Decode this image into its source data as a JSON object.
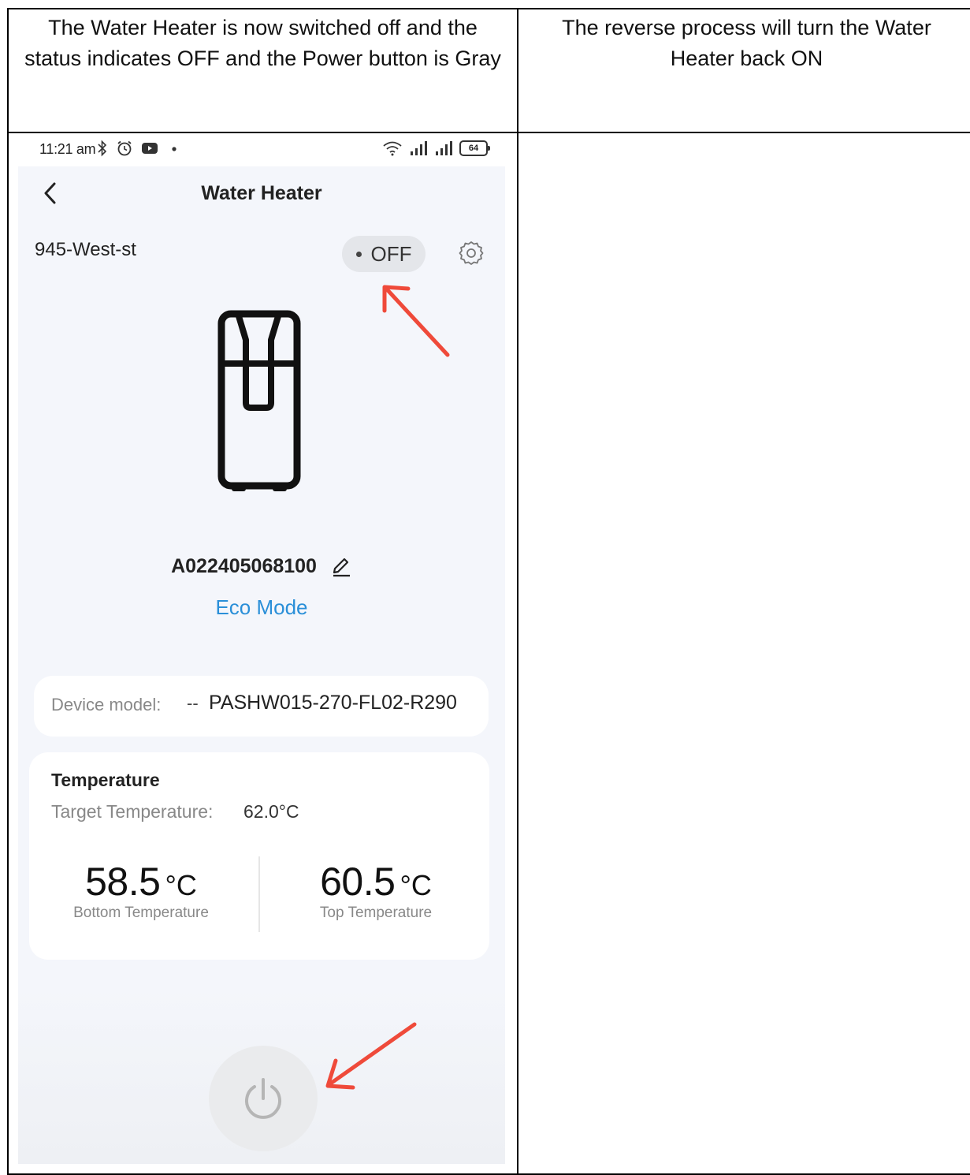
{
  "document": {
    "caption_left": "The Water Heater is now switched off and the status indicates OFF and the Power button is Gray",
    "caption_right": "The reverse process will turn the Water Heater back ON"
  },
  "phone": {
    "status_bar": {
      "time": "11:21 am",
      "battery": "64",
      "icons_left": [
        "bluetooth-icon",
        "alarm-icon",
        "youtube-icon",
        "dot-icon"
      ],
      "icons_right": [
        "wifi-icon",
        "signal-icon",
        "signal-icon",
        "battery-icon"
      ]
    },
    "header": {
      "title": "Water Heater",
      "back_icon": "chevron-left-icon"
    },
    "location": "945-West-st",
    "status": "OFF",
    "settings_icon": "gear-icon",
    "device": {
      "id": "A022405068100",
      "mode": "Eco Mode",
      "model_label": "Device model:",
      "model_separator": "--",
      "model_value": "PASHW015-270-FL02-R290"
    },
    "temperature": {
      "title": "Temperature",
      "target_label": "Target Temperature:",
      "target_value": "62.0°C",
      "bottom_value": "58.5",
      "bottom_unit": "°C",
      "bottom_label": "Bottom Temperature",
      "top_value": "60.5",
      "top_unit": "°C",
      "top_label": "Top Temperature"
    },
    "power_button_state": "off"
  },
  "colors": {
    "accent": "#2a8fd8",
    "arrow": "#ef4a3a",
    "power_off": "#b5b5b5",
    "pill_bg": "#e4e6ea"
  }
}
